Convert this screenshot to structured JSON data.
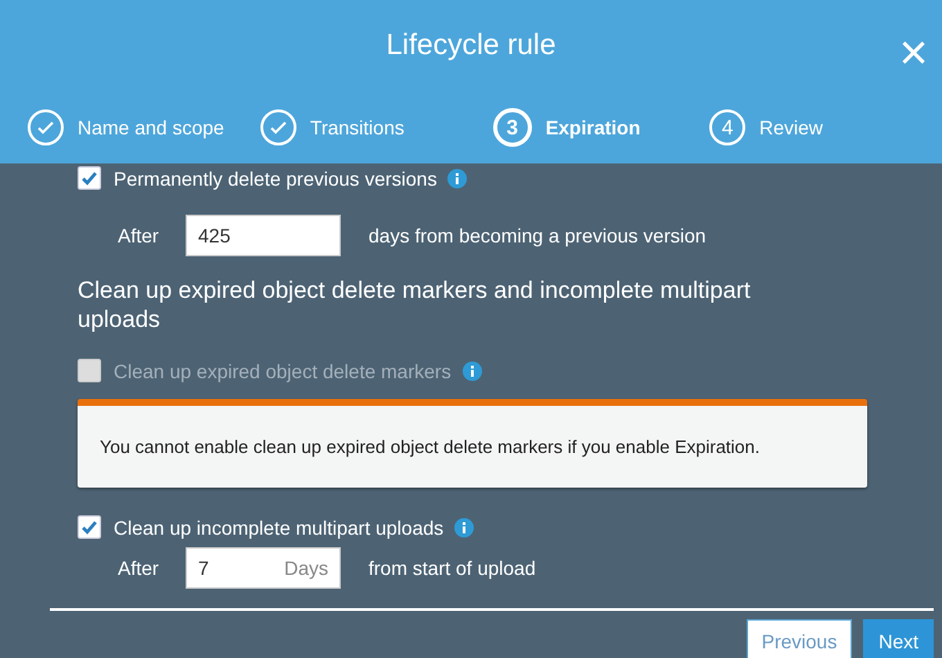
{
  "window": {
    "title": "Lifecycle rule",
    "close": "×"
  },
  "steps": [
    {
      "label": "Name and scope",
      "completed": true,
      "selected": false
    },
    {
      "label": "Transitions",
      "completed": true,
      "selected": false
    },
    {
      "label": "Expiration",
      "number": "3",
      "completed": false,
      "selected": true
    },
    {
      "label": "Review",
      "number": "4",
      "completed": false,
      "selected": false
    }
  ],
  "previous_versions": {
    "label": "Permanently delete previous versions",
    "checked": true,
    "after_label": "After",
    "days": "425",
    "suffix": "days from becoming a previous version"
  },
  "cleanup_heading": "Clean up expired object delete markers and incomplete multipart uploads",
  "delete_markers": {
    "label": "Clean up expired object delete markers",
    "checked": false,
    "disabled": true
  },
  "warning": "You cannot enable clean up expired object delete markers if you enable Expiration.",
  "multipart": {
    "label": "Clean up incomplete multipart uploads",
    "checked": true,
    "disabled": false,
    "after_label": "After",
    "days": "7",
    "unit": "Days",
    "suffix": "from start of upload"
  },
  "buttons": [
    {
      "label": "Previous",
      "kind": "secondary"
    },
    {
      "label": "Next",
      "kind": "primary"
    }
  ]
}
